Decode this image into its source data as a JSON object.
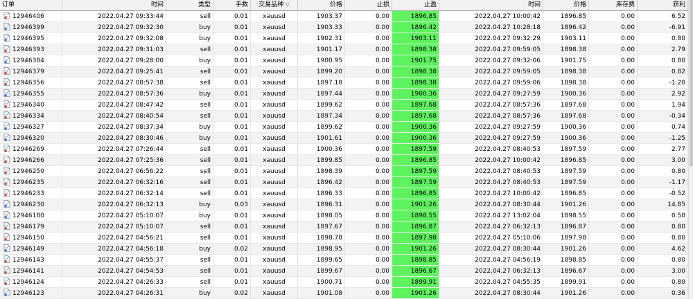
{
  "headers": {
    "order": "订单",
    "open_time": "时间",
    "type": "类型",
    "lots": "手数",
    "symbol": "交易品种",
    "open_price": "价格",
    "sl": "止损",
    "tp": "止盈",
    "close_time": "时间",
    "close_price": "价格",
    "swap": "库存费",
    "profit": "获利"
  },
  "rows": [
    {
      "order": "12946406",
      "open_time": "2022.04.27 09:33:44",
      "type": "sell",
      "lots": "0.01",
      "symbol": "xauusd",
      "open_price": "1903.37",
      "sl": "0.00",
      "tp": "1896.85",
      "close_time": "2022.04.27 10:00:42",
      "close_price": "1896.85",
      "swap": "0.00",
      "profit": "6.52"
    },
    {
      "order": "12946399",
      "open_time": "2022.04.27 09:32:30",
      "type": "buy",
      "lots": "0.01",
      "symbol": "xauusd",
      "open_price": "1903.33",
      "sl": "0.00",
      "tp": "1896.42",
      "close_time": "2022.04.27 10:28:18",
      "close_price": "1896.42",
      "swap": "0.00",
      "profit": "-6.91"
    },
    {
      "order": "12946395",
      "open_time": "2022.04.27 09:32:08",
      "type": "buy",
      "lots": "0.01",
      "symbol": "xauusd",
      "open_price": "1902.31",
      "sl": "0.00",
      "tp": "1903.11",
      "close_time": "2022.04.27 09:32:29",
      "close_price": "1903.11",
      "swap": "0.00",
      "profit": "0.80"
    },
    {
      "order": "12946393",
      "open_time": "2022.04.27 09:31:03",
      "type": "sell",
      "lots": "0.01",
      "symbol": "xauusd",
      "open_price": "1901.17",
      "sl": "0.00",
      "tp": "1898.38",
      "close_time": "2022.04.27 09:59:05",
      "close_price": "1898.38",
      "swap": "0.00",
      "profit": "2.79"
    },
    {
      "order": "12946384",
      "open_time": "2022.04.27 09:28:00",
      "type": "buy",
      "lots": "0.01",
      "symbol": "xauusd",
      "open_price": "1900.95",
      "sl": "0.00",
      "tp": "1901.75",
      "close_time": "2022.04.27 09:32:06",
      "close_price": "1901.75",
      "swap": "0.00",
      "profit": "0.80"
    },
    {
      "order": "12946379",
      "open_time": "2022.04.27 09:25:41",
      "type": "sell",
      "lots": "0.01",
      "symbol": "xauusd",
      "open_price": "1899.20",
      "sl": "0.00",
      "tp": "1898.38",
      "close_time": "2022.04.27 09:59:05",
      "close_price": "1898.38",
      "swap": "0.00",
      "profit": "0.82"
    },
    {
      "order": "12946356",
      "open_time": "2022.04.27 08:57:38",
      "type": "sell",
      "lots": "0.01",
      "symbol": "xauusd",
      "open_price": "1897.18",
      "sl": "0.00",
      "tp": "1898.38",
      "close_time": "2022.04.27 09:59:06",
      "close_price": "1898.38",
      "swap": "0.00",
      "profit": "-1.20"
    },
    {
      "order": "12946355",
      "open_time": "2022.04.27 08:57:36",
      "type": "buy",
      "lots": "0.01",
      "symbol": "xauusd",
      "open_price": "1897.44",
      "sl": "0.00",
      "tp": "1900.36",
      "close_time": "2022.04.27 09:27:59",
      "close_price": "1900.36",
      "swap": "0.00",
      "profit": "2.92"
    },
    {
      "order": "12946340",
      "open_time": "2022.04.27 08:47:42",
      "type": "sell",
      "lots": "0.01",
      "symbol": "xauusd",
      "open_price": "1899.62",
      "sl": "0.00",
      "tp": "1897.68",
      "close_time": "2022.04.27 08:57:36",
      "close_price": "1897.68",
      "swap": "0.00",
      "profit": "1.94"
    },
    {
      "order": "12946334",
      "open_time": "2022.04.27 08:40:54",
      "type": "sell",
      "lots": "0.01",
      "symbol": "xauusd",
      "open_price": "1897.34",
      "sl": "0.00",
      "tp": "1897.68",
      "close_time": "2022.04.27 08:57:36",
      "close_price": "1897.68",
      "swap": "0.00",
      "profit": "-0.34"
    },
    {
      "order": "12946327",
      "open_time": "2022.04.27 08:37:34",
      "type": "buy",
      "lots": "0.01",
      "symbol": "xauusd",
      "open_price": "1899.62",
      "sl": "0.00",
      "tp": "1900.36",
      "close_time": "2022.04.27 09:27:59",
      "close_price": "1900.36",
      "swap": "0.00",
      "profit": "0.74"
    },
    {
      "order": "12946320",
      "open_time": "2022.04.27 08:30:46",
      "type": "buy",
      "lots": "0.01",
      "symbol": "xauusd",
      "open_price": "1901.61",
      "sl": "0.00",
      "tp": "1900.36",
      "close_time": "2022.04.27 09:27:59",
      "close_price": "1900.36",
      "swap": "0.00",
      "profit": "-1.25"
    },
    {
      "order": "12946269",
      "open_time": "2022.04.27 07:26:44",
      "type": "sell",
      "lots": "0.01",
      "symbol": "xauusd",
      "open_price": "1900.36",
      "sl": "0.00",
      "tp": "1897.59",
      "close_time": "2022.04.27 08:40:53",
      "close_price": "1897.59",
      "swap": "0.00",
      "profit": "2.77"
    },
    {
      "order": "12946266",
      "open_time": "2022.04.27 07:25:36",
      "type": "sell",
      "lots": "0.01",
      "symbol": "xauusd",
      "open_price": "1899.85",
      "sl": "0.00",
      "tp": "1896.85",
      "close_time": "2022.04.27 10:00:42",
      "close_price": "1896.85",
      "swap": "0.00",
      "profit": "3.00"
    },
    {
      "order": "12946250",
      "open_time": "2022.04.27 06:56:22",
      "type": "sell",
      "lots": "0.01",
      "symbol": "xauusd",
      "open_price": "1898.39",
      "sl": "0.00",
      "tp": "1897.59",
      "close_time": "2022.04.27 08:40:53",
      "close_price": "1897.59",
      "swap": "0.00",
      "profit": "0.80"
    },
    {
      "order": "12946235",
      "open_time": "2022.04.27 06:32:16",
      "type": "sell",
      "lots": "0.01",
      "symbol": "xauusd",
      "open_price": "1896.42",
      "sl": "0.00",
      "tp": "1897.59",
      "close_time": "2022.04.27 08:40:53",
      "close_price": "1897.59",
      "swap": "0.00",
      "profit": "-1.17"
    },
    {
      "order": "12946233",
      "open_time": "2022.04.27 06:32:14",
      "type": "sell",
      "lots": "0.01",
      "symbol": "xauusd",
      "open_price": "1896.33",
      "sl": "0.00",
      "tp": "1896.85",
      "close_time": "2022.04.27 10:00:42",
      "close_price": "1896.85",
      "swap": "0.00",
      "profit": "-0.52"
    },
    {
      "order": "12946230",
      "open_time": "2022.04.27 06:32:13",
      "type": "buy",
      "lots": "0.03",
      "symbol": "xauusd",
      "open_price": "1896.31",
      "sl": "0.00",
      "tp": "1901.26",
      "close_time": "2022.04.27 08:30:44",
      "close_price": "1901.26",
      "swap": "0.00",
      "profit": "14.85"
    },
    {
      "order": "12946180",
      "open_time": "2022.04.27 05:10:07",
      "type": "buy",
      "lots": "0.01",
      "symbol": "xauusd",
      "open_price": "1898.05",
      "sl": "0.00",
      "tp": "1898.55",
      "close_time": "2022.04.27 13:02:04",
      "close_price": "1898.55",
      "swap": "0.00",
      "profit": "0.50"
    },
    {
      "order": "12946179",
      "open_time": "2022.04.27 05:10:07",
      "type": "sell",
      "lots": "0.01",
      "symbol": "xauusd",
      "open_price": "1897.67",
      "sl": "0.00",
      "tp": "1896.87",
      "close_time": "2022.04.27 06:32:13",
      "close_price": "1896.87",
      "swap": "0.00",
      "profit": "0.80"
    },
    {
      "order": "12946150",
      "open_time": "2022.04.27 04:56:21",
      "type": "sell",
      "lots": "0.01",
      "symbol": "xauusd",
      "open_price": "1898.78",
      "sl": "0.00",
      "tp": "1897.98",
      "close_time": "2022.04.27 05:10:06",
      "close_price": "1897.98",
      "swap": "0.00",
      "profit": "0.80"
    },
    {
      "order": "12946149",
      "open_time": "2022.04.27 04:56:18",
      "type": "buy",
      "lots": "0.02",
      "symbol": "xauusd",
      "open_price": "1898.95",
      "sl": "0.00",
      "tp": "1901.26",
      "close_time": "2022.04.27 08:30:44",
      "close_price": "1901.26",
      "swap": "0.00",
      "profit": "4.62"
    },
    {
      "order": "12946143",
      "open_time": "2022.04.27 04:55:37",
      "type": "sell",
      "lots": "0.01",
      "symbol": "xauusd",
      "open_price": "1899.65",
      "sl": "0.00",
      "tp": "1898.85",
      "close_time": "2022.04.27 04:56:19",
      "close_price": "1898.85",
      "swap": "0.00",
      "profit": "0.80"
    },
    {
      "order": "12946141",
      "open_time": "2022.04.27 04:54:53",
      "type": "sell",
      "lots": "0.01",
      "symbol": "xauusd",
      "open_price": "1899.67",
      "sl": "0.00",
      "tp": "1896.67",
      "close_time": "2022.04.27 06:32:13",
      "close_price": "1896.67",
      "swap": "0.00",
      "profit": "3.00"
    },
    {
      "order": "12946124",
      "open_time": "2022.04.27 04:26:33",
      "type": "sell",
      "lots": "0.01",
      "symbol": "xauusd",
      "open_price": "1900.71",
      "sl": "0.00",
      "tp": "1899.91",
      "close_time": "2022.04.27 04:55:35",
      "close_price": "1899.91",
      "swap": "0.00",
      "profit": "0.80"
    },
    {
      "order": "12946123",
      "open_time": "2022.04.27 04:26:31",
      "type": "buy",
      "lots": "0.02",
      "symbol": "xauusd",
      "open_price": "1901.08",
      "sl": "0.00",
      "tp": "1901.26",
      "close_time": "2022.04.27 08:30:44",
      "close_price": "1901.26",
      "swap": "0.00",
      "profit": "0.36"
    }
  ],
  "colors": {
    "tp_highlight": "#5ef35e",
    "row_alt": "#f3f3f3",
    "header_bg": "#f2f2f2"
  },
  "icons": {
    "sell": "sell-order-icon",
    "buy": "buy-order-icon"
  }
}
